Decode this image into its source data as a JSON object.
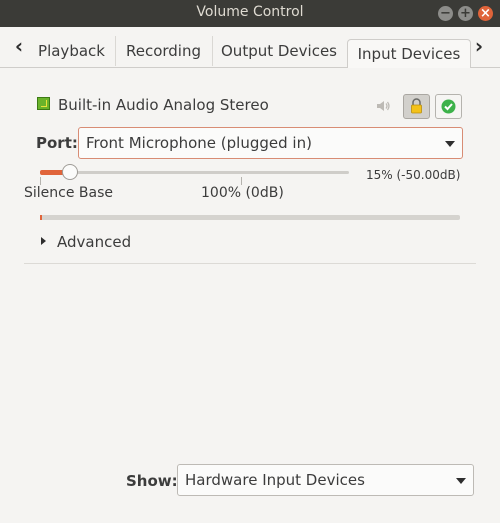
{
  "window": {
    "title": "Volume Control",
    "buttons": {
      "minimize": "−",
      "maximize": "+",
      "close": "×"
    }
  },
  "tabs": {
    "items": [
      {
        "label": "Playback"
      },
      {
        "label": "Recording"
      },
      {
        "label": "Output Devices"
      },
      {
        "label": "Input Devices"
      }
    ],
    "active": "Input Devices",
    "scroll_left": "‹",
    "scroll_right": "›"
  },
  "device": {
    "name": "Built-in Audio Analog Stereo",
    "icon": "audio-card-icon",
    "mute_icon": "speaker-icon",
    "lock_icon": "lock-icon",
    "default_icon": "check-circle-icon",
    "port_label": "Port:",
    "port_value": "Front Microphone (plugged in)",
    "volume": {
      "percent": 15,
      "readout": "15% (-50.00dB)",
      "silence_label": "Silence Base",
      "unity_label": "100% (0dB)"
    },
    "level_meter": 0.005,
    "advanced_label": "Advanced"
  },
  "footer": {
    "show_label": "Show:",
    "show_value": "Hardware Input Devices"
  },
  "colors": {
    "accent": "#e0643a",
    "titlebar": "#3b3b37",
    "default_green": "#3db24a",
    "lock_yellow": "#f4c21a"
  }
}
